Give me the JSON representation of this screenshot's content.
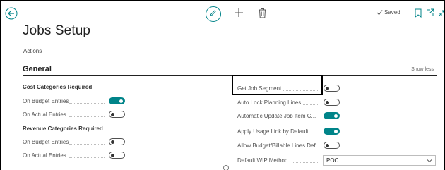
{
  "page": {
    "title": "Jobs Setup",
    "saved_text": "Saved"
  },
  "actions": {
    "label": "Actions"
  },
  "general": {
    "heading": "General",
    "show_less": "Show less",
    "cost_group": {
      "heading": "Cost Categories Required",
      "fields": [
        {
          "label": "On Budget Entries",
          "value": true
        },
        {
          "label": "On Actual Entries",
          "value": false
        }
      ]
    },
    "revenue_group": {
      "heading": "Revenue Categories Required",
      "fields": [
        {
          "label": "On Budget Entries",
          "value": false
        },
        {
          "label": "On Actual Entries",
          "value": false
        }
      ]
    },
    "right_fields": [
      {
        "label": "Get Job Segment",
        "value": false
      },
      {
        "label": "Auto.Lock Planning Lines",
        "value": false
      },
      {
        "label": "Automatic Update Job Item C...",
        "value": true
      },
      {
        "label": "Apply Usage Link by Default",
        "value": true
      },
      {
        "label": "Allow Budget/Billable Lines Def",
        "value": false
      }
    ],
    "wip": {
      "label": "Default WIP Method",
      "value": "POC"
    }
  },
  "colors": {
    "accent": "#008489",
    "text": "#212121"
  },
  "icons": {
    "back": "arrow-left-icon",
    "edit": "pencil-icon",
    "new": "plus-icon",
    "delete": "trash-icon",
    "saved": "checkmark-icon",
    "bookmark": "bookmark-icon",
    "popout": "popout-icon",
    "collapse": "collapse-icon",
    "dropdown": "chevron-down-icon"
  }
}
